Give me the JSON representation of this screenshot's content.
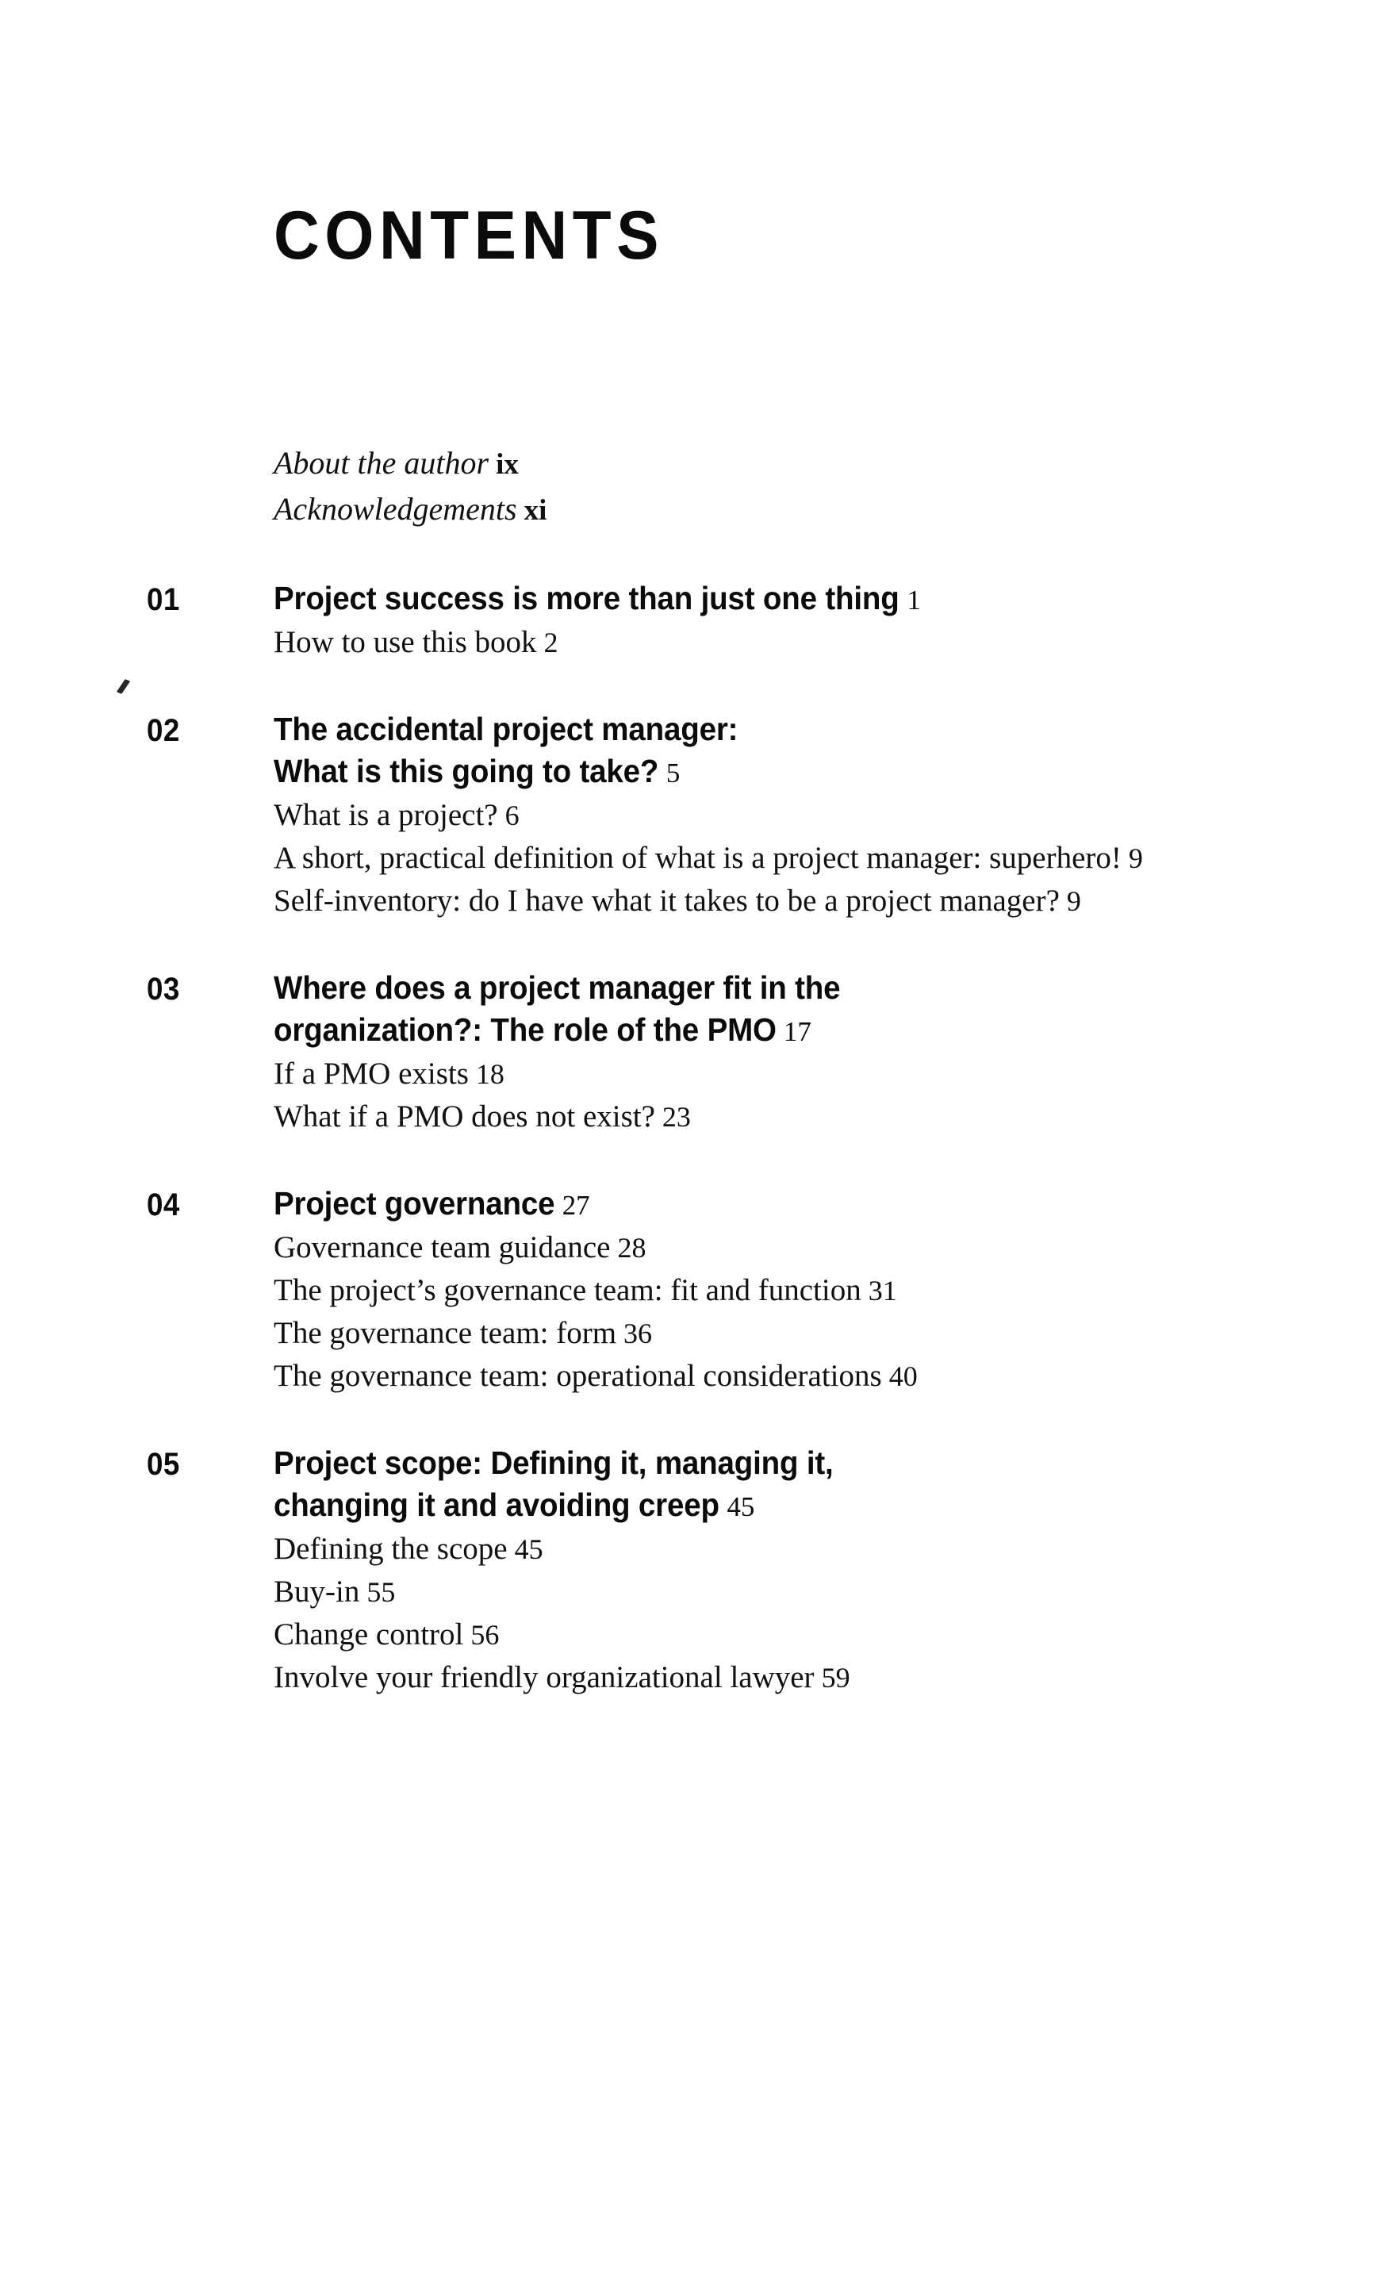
{
  "page": {
    "title": "CONTENTS",
    "background_color": "#ffffff",
    "text_color": "#111111"
  },
  "frontmatter": [
    {
      "label": "About the author",
      "page": "ix"
    },
    {
      "label": "Acknowledgements",
      "page": "xi"
    }
  ],
  "chapters": [
    {
      "number": "01",
      "title_lines": [
        "Project success is more than just one thing"
      ],
      "page": "1",
      "sections": [
        {
          "label": "How to use this book",
          "page": "2"
        }
      ]
    },
    {
      "number": "02",
      "title_lines": [
        "The accidental project manager:",
        "What is this going to take?"
      ],
      "page": "5",
      "sections": [
        {
          "label": "What is a project?",
          "page": "6"
        },
        {
          "label": "A short, practical definition of what is a project manager: superhero!",
          "page": "9"
        },
        {
          "label": "Self-inventory: do I have what it takes to be a project manager?",
          "page": "9"
        }
      ]
    },
    {
      "number": "03",
      "title_lines": [
        "Where does a project manager fit in the",
        "organization?: The role of the PMO"
      ],
      "page": "17",
      "sections": [
        {
          "label": "If a PMO exists",
          "page": "18"
        },
        {
          "label": "What if a PMO does not exist?",
          "page": "23"
        }
      ]
    },
    {
      "number": "04",
      "title_lines": [
        "Project governance"
      ],
      "page": "27",
      "sections": [
        {
          "label": "Governance team guidance",
          "page": "28"
        },
        {
          "label": "The project’s governance team: fit and function",
          "page": "31"
        },
        {
          "label": "The governance team: form",
          "page": "36"
        },
        {
          "label": "The governance team: operational considerations",
          "page": "40"
        }
      ]
    },
    {
      "number": "05",
      "title_lines": [
        "Project scope: Defining it, managing it,",
        "changing it and avoiding creep"
      ],
      "page": "45",
      "sections": [
        {
          "label": "Defining the scope",
          "page": "45"
        },
        {
          "label": "Buy-in",
          "page": "55"
        },
        {
          "label": "Change control",
          "page": "56"
        },
        {
          "label": "Involve your friendly organizational lawyer",
          "page": "59"
        }
      ]
    }
  ]
}
